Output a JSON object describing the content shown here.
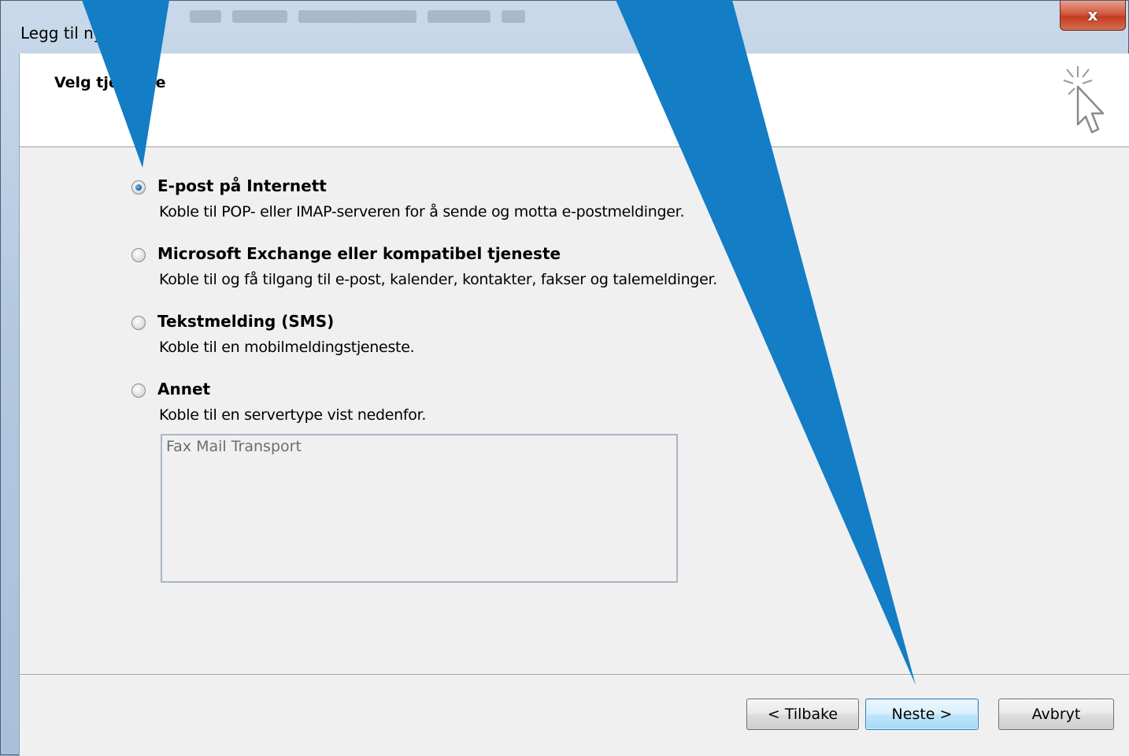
{
  "window": {
    "title": "Legg til ny konto",
    "close_label": "x"
  },
  "header": {
    "heading": "Velg tjeneste"
  },
  "options": [
    {
      "label": "E-post på Internett",
      "description": "Koble til POP- eller IMAP-serveren for å sende og motta e-postmeldinger.",
      "checked": true
    },
    {
      "label": "Microsoft Exchange eller kompatibel tjeneste",
      "description": "Koble til og få tilgang til e-post, kalender, kontakter, fakser og talemeldinger.",
      "checked": false
    },
    {
      "label": "Tekstmelding (SMS)",
      "description": "Koble til en mobilmeldingstjeneste.",
      "checked": false
    },
    {
      "label": "Annet",
      "description": "Koble til en servertype vist nedenfor.",
      "checked": false
    }
  ],
  "server_list": {
    "items": [
      "Fax Mail Transport"
    ]
  },
  "buttons": {
    "back": "< Tilbake",
    "next": "Neste >",
    "cancel": "Avbryt"
  },
  "colors": {
    "annotation_arrow": "#137dc5"
  }
}
